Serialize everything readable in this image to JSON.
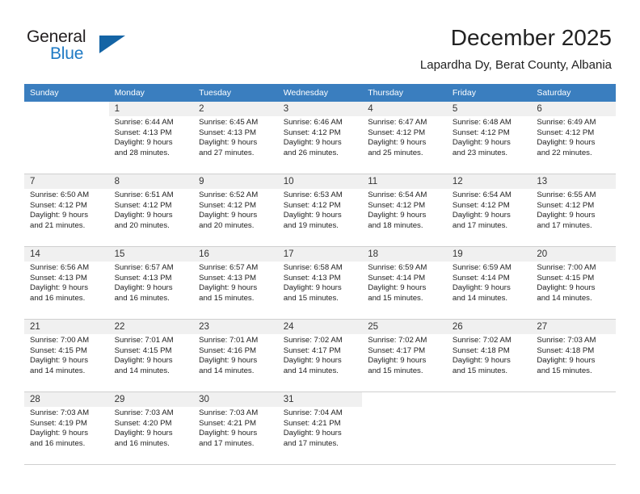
{
  "logo": {
    "word1": "General",
    "word2": "Blue",
    "triangle_color": "#1464a5",
    "blue_color": "#1f7ac4"
  },
  "header": {
    "title": "December 2025",
    "subtitle": "Lapardha Dy, Berat County, Albania"
  },
  "theme": {
    "header_row_bg": "#3a7ebf",
    "header_row_text": "#ffffff",
    "shaded_daynum_bg": "#f0f0f0",
    "grid_line": "#cfcfcf"
  },
  "weekday_headers": [
    "Sunday",
    "Monday",
    "Tuesday",
    "Wednesday",
    "Thursday",
    "Friday",
    "Saturday"
  ],
  "labels": {
    "sunrise_prefix": "Sunrise:",
    "sunset_prefix": "Sunset:",
    "daylight_prefix": "Daylight:"
  },
  "weeks": [
    [
      {
        "day": "",
        "empty": true,
        "sunrise": "",
        "sunset": "",
        "daylight_line1": "",
        "daylight_line2": ""
      },
      {
        "day": "1",
        "sunrise": "Sunrise: 6:44 AM",
        "sunset": "Sunset: 4:13 PM",
        "daylight_line1": "Daylight: 9 hours",
        "daylight_line2": "and 28 minutes."
      },
      {
        "day": "2",
        "sunrise": "Sunrise: 6:45 AM",
        "sunset": "Sunset: 4:13 PM",
        "daylight_line1": "Daylight: 9 hours",
        "daylight_line2": "and 27 minutes."
      },
      {
        "day": "3",
        "sunrise": "Sunrise: 6:46 AM",
        "sunset": "Sunset: 4:12 PM",
        "daylight_line1": "Daylight: 9 hours",
        "daylight_line2": "and 26 minutes."
      },
      {
        "day": "4",
        "sunrise": "Sunrise: 6:47 AM",
        "sunset": "Sunset: 4:12 PM",
        "daylight_line1": "Daylight: 9 hours",
        "daylight_line2": "and 25 minutes."
      },
      {
        "day": "5",
        "sunrise": "Sunrise: 6:48 AM",
        "sunset": "Sunset: 4:12 PM",
        "daylight_line1": "Daylight: 9 hours",
        "daylight_line2": "and 23 minutes."
      },
      {
        "day": "6",
        "sunrise": "Sunrise: 6:49 AM",
        "sunset": "Sunset: 4:12 PM",
        "daylight_line1": "Daylight: 9 hours",
        "daylight_line2": "and 22 minutes."
      }
    ],
    [
      {
        "day": "7",
        "sunrise": "Sunrise: 6:50 AM",
        "sunset": "Sunset: 4:12 PM",
        "daylight_line1": "Daylight: 9 hours",
        "daylight_line2": "and 21 minutes."
      },
      {
        "day": "8",
        "sunrise": "Sunrise: 6:51 AM",
        "sunset": "Sunset: 4:12 PM",
        "daylight_line1": "Daylight: 9 hours",
        "daylight_line2": "and 20 minutes."
      },
      {
        "day": "9",
        "sunrise": "Sunrise: 6:52 AM",
        "sunset": "Sunset: 4:12 PM",
        "daylight_line1": "Daylight: 9 hours",
        "daylight_line2": "and 20 minutes."
      },
      {
        "day": "10",
        "sunrise": "Sunrise: 6:53 AM",
        "sunset": "Sunset: 4:12 PM",
        "daylight_line1": "Daylight: 9 hours",
        "daylight_line2": "and 19 minutes."
      },
      {
        "day": "11",
        "sunrise": "Sunrise: 6:54 AM",
        "sunset": "Sunset: 4:12 PM",
        "daylight_line1": "Daylight: 9 hours",
        "daylight_line2": "and 18 minutes."
      },
      {
        "day": "12",
        "sunrise": "Sunrise: 6:54 AM",
        "sunset": "Sunset: 4:12 PM",
        "daylight_line1": "Daylight: 9 hours",
        "daylight_line2": "and 17 minutes."
      },
      {
        "day": "13",
        "sunrise": "Sunrise: 6:55 AM",
        "sunset": "Sunset: 4:12 PM",
        "daylight_line1": "Daylight: 9 hours",
        "daylight_line2": "and 17 minutes."
      }
    ],
    [
      {
        "day": "14",
        "sunrise": "Sunrise: 6:56 AM",
        "sunset": "Sunset: 4:13 PM",
        "daylight_line1": "Daylight: 9 hours",
        "daylight_line2": "and 16 minutes."
      },
      {
        "day": "15",
        "sunrise": "Sunrise: 6:57 AM",
        "sunset": "Sunset: 4:13 PM",
        "daylight_line1": "Daylight: 9 hours",
        "daylight_line2": "and 16 minutes."
      },
      {
        "day": "16",
        "sunrise": "Sunrise: 6:57 AM",
        "sunset": "Sunset: 4:13 PM",
        "daylight_line1": "Daylight: 9 hours",
        "daylight_line2": "and 15 minutes."
      },
      {
        "day": "17",
        "sunrise": "Sunrise: 6:58 AM",
        "sunset": "Sunset: 4:13 PM",
        "daylight_line1": "Daylight: 9 hours",
        "daylight_line2": "and 15 minutes."
      },
      {
        "day": "18",
        "sunrise": "Sunrise: 6:59 AM",
        "sunset": "Sunset: 4:14 PM",
        "daylight_line1": "Daylight: 9 hours",
        "daylight_line2": "and 15 minutes."
      },
      {
        "day": "19",
        "sunrise": "Sunrise: 6:59 AM",
        "sunset": "Sunset: 4:14 PM",
        "daylight_line1": "Daylight: 9 hours",
        "daylight_line2": "and 14 minutes."
      },
      {
        "day": "20",
        "sunrise": "Sunrise: 7:00 AM",
        "sunset": "Sunset: 4:15 PM",
        "daylight_line1": "Daylight: 9 hours",
        "daylight_line2": "and 14 minutes."
      }
    ],
    [
      {
        "day": "21",
        "sunrise": "Sunrise: 7:00 AM",
        "sunset": "Sunset: 4:15 PM",
        "daylight_line1": "Daylight: 9 hours",
        "daylight_line2": "and 14 minutes."
      },
      {
        "day": "22",
        "sunrise": "Sunrise: 7:01 AM",
        "sunset": "Sunset: 4:15 PM",
        "daylight_line1": "Daylight: 9 hours",
        "daylight_line2": "and 14 minutes."
      },
      {
        "day": "23",
        "sunrise": "Sunrise: 7:01 AM",
        "sunset": "Sunset: 4:16 PM",
        "daylight_line1": "Daylight: 9 hours",
        "daylight_line2": "and 14 minutes."
      },
      {
        "day": "24",
        "sunrise": "Sunrise: 7:02 AM",
        "sunset": "Sunset: 4:17 PM",
        "daylight_line1": "Daylight: 9 hours",
        "daylight_line2": "and 14 minutes."
      },
      {
        "day": "25",
        "sunrise": "Sunrise: 7:02 AM",
        "sunset": "Sunset: 4:17 PM",
        "daylight_line1": "Daylight: 9 hours",
        "daylight_line2": "and 15 minutes."
      },
      {
        "day": "26",
        "sunrise": "Sunrise: 7:02 AM",
        "sunset": "Sunset: 4:18 PM",
        "daylight_line1": "Daylight: 9 hours",
        "daylight_line2": "and 15 minutes."
      },
      {
        "day": "27",
        "sunrise": "Sunrise: 7:03 AM",
        "sunset": "Sunset: 4:18 PM",
        "daylight_line1": "Daylight: 9 hours",
        "daylight_line2": "and 15 minutes."
      }
    ],
    [
      {
        "day": "28",
        "sunrise": "Sunrise: 7:03 AM",
        "sunset": "Sunset: 4:19 PM",
        "daylight_line1": "Daylight: 9 hours",
        "daylight_line2": "and 16 minutes."
      },
      {
        "day": "29",
        "sunrise": "Sunrise: 7:03 AM",
        "sunset": "Sunset: 4:20 PM",
        "daylight_line1": "Daylight: 9 hours",
        "daylight_line2": "and 16 minutes."
      },
      {
        "day": "30",
        "sunrise": "Sunrise: 7:03 AM",
        "sunset": "Sunset: 4:21 PM",
        "daylight_line1": "Daylight: 9 hours",
        "daylight_line2": "and 17 minutes."
      },
      {
        "day": "31",
        "sunrise": "Sunrise: 7:04 AM",
        "sunset": "Sunset: 4:21 PM",
        "daylight_line1": "Daylight: 9 hours",
        "daylight_line2": "and 17 minutes."
      },
      {
        "day": "",
        "empty": true,
        "sunrise": "",
        "sunset": "",
        "daylight_line1": "",
        "daylight_line2": ""
      },
      {
        "day": "",
        "empty": true,
        "sunrise": "",
        "sunset": "",
        "daylight_line1": "",
        "daylight_line2": ""
      },
      {
        "day": "",
        "empty": true,
        "sunrise": "",
        "sunset": "",
        "daylight_line1": "",
        "daylight_line2": ""
      }
    ]
  ]
}
